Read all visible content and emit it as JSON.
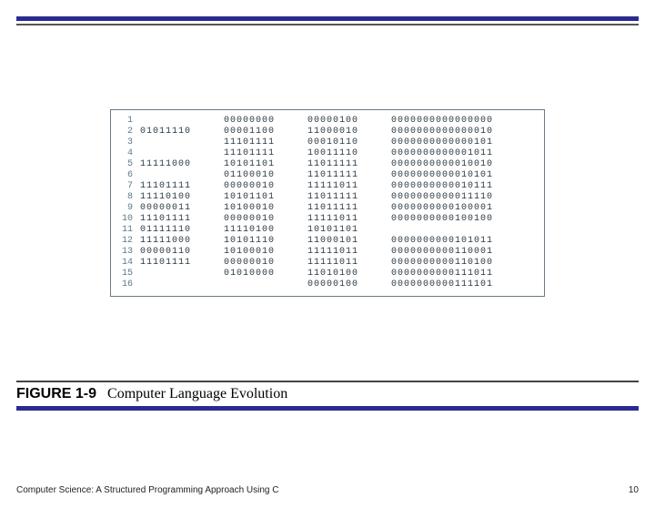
{
  "caption": {
    "label": "FIGURE 1-9",
    "title": "Computer Language Evolution"
  },
  "footer": {
    "source": "Computer Science: A Structured Programming Approach Using C",
    "page": "10"
  },
  "code": {
    "rows": [
      {
        "n": "1",
        "c1": "",
        "c2": "00000000",
        "c3": "00000100",
        "c4": "0000000000000000"
      },
      {
        "n": "2",
        "c1": "01011110",
        "c2": "00001100",
        "c3": "11000010",
        "c4": "0000000000000010"
      },
      {
        "n": "3",
        "c1": "",
        "c2": "11101111",
        "c3": "00010110",
        "c4": "0000000000000101"
      },
      {
        "n": "4",
        "c1": "",
        "c2": "11101111",
        "c3": "10011110",
        "c4": "0000000000001011"
      },
      {
        "n": "5",
        "c1": "11111000",
        "c2": "10101101",
        "c3": "11011111",
        "c4": "0000000000010010"
      },
      {
        "n": "6",
        "c1": "",
        "c2": "01100010",
        "c3": "11011111",
        "c4": "0000000000010101"
      },
      {
        "n": "7",
        "c1": "11101111",
        "c2": "00000010",
        "c3": "11111011",
        "c4": "0000000000010111"
      },
      {
        "n": "8",
        "c1": "11110100",
        "c2": "10101101",
        "c3": "11011111",
        "c4": "0000000000011110"
      },
      {
        "n": "9",
        "c1": "00000011",
        "c2": "10100010",
        "c3": "11011111",
        "c4": "0000000000100001"
      },
      {
        "n": "10",
        "c1": "11101111",
        "c2": "00000010",
        "c3": "11111011",
        "c4": "0000000000100100"
      },
      {
        "n": "11",
        "c1": "01111110",
        "c2": "11110100",
        "c3": "10101101",
        "c4": ""
      },
      {
        "n": "12",
        "c1": "11111000",
        "c2": "10101110",
        "c3": "11000101",
        "c4": "0000000000101011"
      },
      {
        "n": "13",
        "c1": "00000110",
        "c2": "10100010",
        "c3": "11111011",
        "c4": "0000000000110001"
      },
      {
        "n": "14",
        "c1": "11101111",
        "c2": "00000010",
        "c3": "11111011",
        "c4": "0000000000110100"
      },
      {
        "n": "15",
        "c1": "",
        "c2": "01010000",
        "c3": "11010100",
        "c4": "0000000000111011"
      },
      {
        "n": "16",
        "c1": "",
        "c2": "",
        "c3": "00000100",
        "c4": "0000000000111101"
      }
    ]
  }
}
